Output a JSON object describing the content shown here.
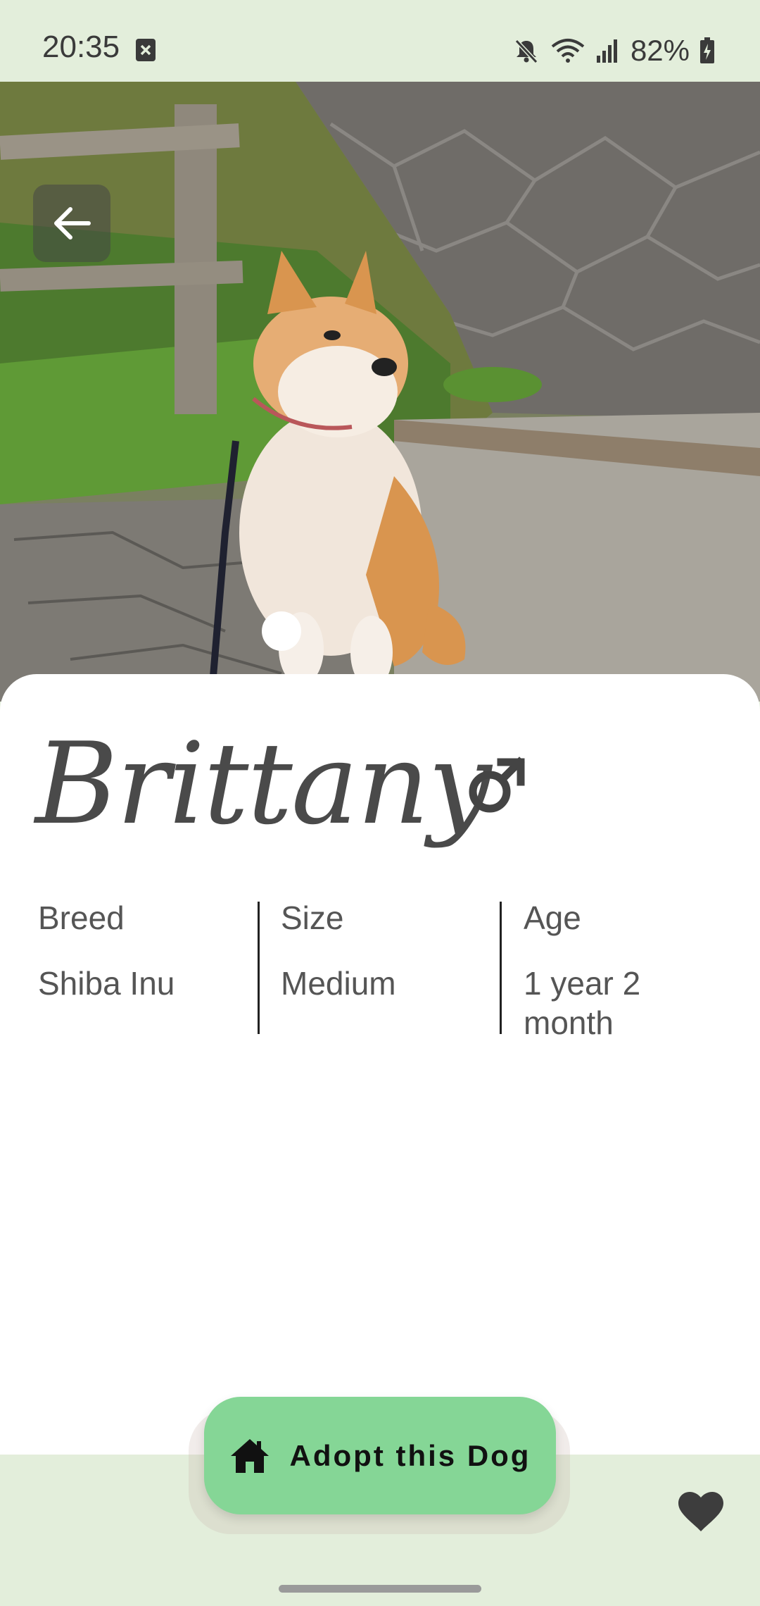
{
  "status_bar": {
    "time": "20:35",
    "battery_percent": "82%",
    "icons": [
      "notification-x-icon",
      "mute-icon",
      "wifi-icon",
      "signal-icon",
      "battery-charging-icon"
    ]
  },
  "hero": {
    "image_alt": "Shiba Inu dog sitting on stone path",
    "back_icon": "arrow-left-icon"
  },
  "dog": {
    "name": "Brittany",
    "gender_icon": "male-symbol-icon",
    "info": [
      {
        "label": "Breed",
        "value": "Shiba Inu"
      },
      {
        "label": "Size",
        "value": "Medium"
      },
      {
        "label": "Age",
        "value": "1 year 2 month"
      }
    ]
  },
  "actions": {
    "adopt_label": "Adopt this Dog",
    "adopt_icon": "home-icon",
    "favorite_icon": "heart-icon"
  },
  "colors": {
    "background": "#e3eedb",
    "accent_button": "#85d696",
    "card": "#ffffff"
  }
}
